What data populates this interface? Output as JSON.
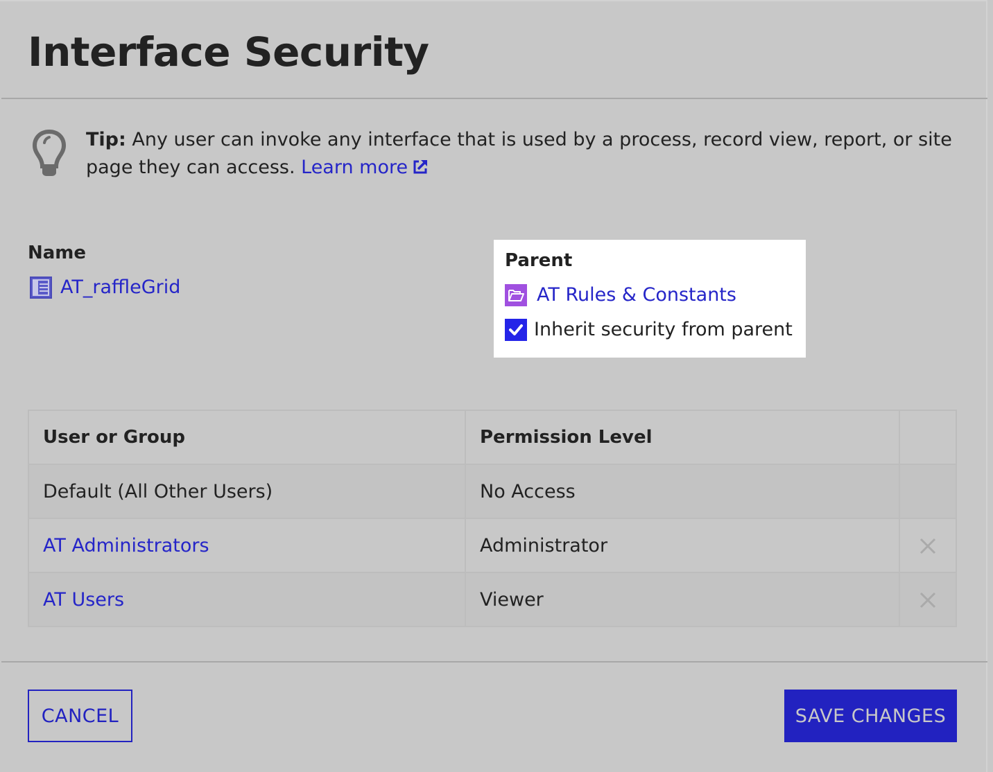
{
  "dialog": {
    "title": "Interface Security"
  },
  "tip": {
    "icon": "lightbulb-icon",
    "label": "Tip:",
    "text": " Any user can invoke any interface that is used by a process, record view, report, or site page they can access. ",
    "link_label": "Learn more",
    "link_icon": "external-link-icon"
  },
  "name_field": {
    "label": "Name",
    "icon": "grid-interface-icon",
    "value": "AT_raffleGrid"
  },
  "parent_field": {
    "label": "Parent",
    "icon": "folder-open-icon",
    "value": "AT Rules & Constants",
    "inherit_label": "Inherit security from parent",
    "inherit_checked": true
  },
  "permissions_table": {
    "columns": [
      "User or Group",
      "Permission Level",
      ""
    ],
    "rows": [
      {
        "user": "Default (All Other Users)",
        "is_link": false,
        "level": "No Access",
        "removable": false
      },
      {
        "user": "AT Administrators",
        "is_link": true,
        "level": "Administrator",
        "removable": true
      },
      {
        "user": "AT Users",
        "is_link": true,
        "level": "Viewer",
        "removable": true
      }
    ]
  },
  "footer": {
    "cancel_label": "CANCEL",
    "save_label": "SAVE CHANGES"
  },
  "colors": {
    "accent": "#2222c0",
    "link": "#2525c8",
    "checkbox": "#2424e8",
    "folder_icon": "#a050e0",
    "background": "#c8c8c8"
  }
}
